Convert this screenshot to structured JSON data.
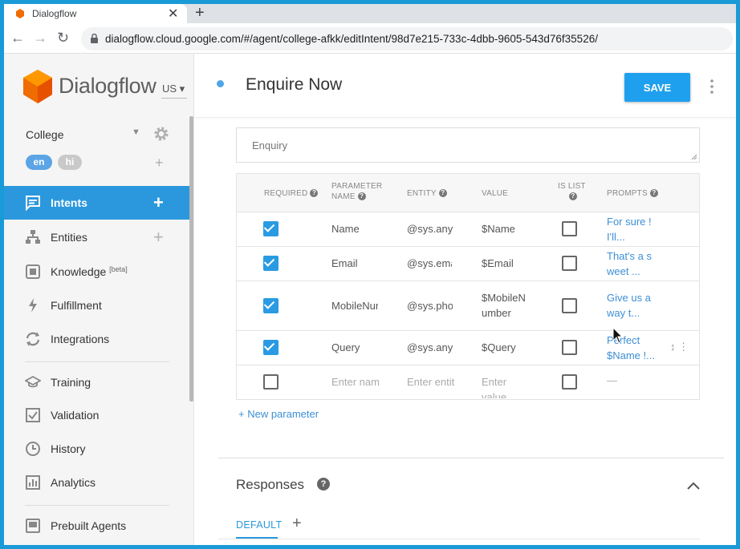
{
  "browser": {
    "tab_title": "Dialogflow",
    "tab_close": "✕",
    "new_tab": "+",
    "back": "←",
    "forward": "→",
    "reload": "↻",
    "url": "dialogflow.cloud.google.com/#/agent/college-afkk/editIntent/98d7e215-733c-4dbb-9605-543d76f35526/"
  },
  "sidebar": {
    "brand": "Dialogflow",
    "region": "US ▾",
    "agent": "College",
    "agent_caret": "▼",
    "languages": [
      "en",
      "hi"
    ],
    "add_language": "+",
    "items": [
      {
        "label": "Intents",
        "icon": "intents-icon",
        "active": true,
        "plus": "+"
      },
      {
        "label": "Entities",
        "icon": "entities-icon",
        "plus": "+"
      },
      {
        "label": "Knowledge",
        "sup": "[beta]",
        "icon": "knowledge-icon"
      },
      {
        "label": "Fulfillment",
        "icon": "fulfillment-icon"
      },
      {
        "label": "Integrations",
        "icon": "integrations-icon"
      },
      {
        "label": "Training",
        "icon": "training-icon"
      },
      {
        "label": "Validation",
        "icon": "validation-icon"
      },
      {
        "label": "History",
        "icon": "history-icon"
      },
      {
        "label": "Analytics",
        "icon": "analytics-icon"
      },
      {
        "label": "Prebuilt Agents",
        "icon": "prebuilt-agents-icon"
      }
    ]
  },
  "header": {
    "intent_name": "Enquire Now",
    "save_label": "SAVE"
  },
  "action": {
    "placeholder": "Enquiry"
  },
  "parameters": {
    "headers": {
      "required": "REQUIRED",
      "parameter_name_1": "PARAMETER",
      "parameter_name_2": "NAME",
      "entity": "ENTITY",
      "value": "VALUE",
      "is_list": "IS LIST",
      "prompts": "PROMPTS",
      "help": "?"
    },
    "rows": [
      {
        "required": true,
        "name": "Name",
        "entity": "@sys.any",
        "value": "$Name",
        "is_list": false,
        "prompt": "For sure ! I'll..."
      },
      {
        "required": true,
        "name": "Email",
        "entity": "@sys.ema",
        "value": "$Email",
        "is_list": false,
        "prompt": "That's a s weet ..."
      },
      {
        "required": true,
        "name": "MobileNur",
        "entity": "@sys.phor",
        "value": "$MobileN umber",
        "is_list": false,
        "prompt": "Give us a way t..."
      },
      {
        "required": true,
        "name": "Query",
        "entity": "@sys.any",
        "value": "$Query",
        "is_list": false,
        "prompt": "Perfect $Name !..."
      }
    ],
    "empty_row": {
      "name_placeholder": "Enter nam",
      "entity_placeholder": "Enter entit",
      "value_placeholder": "Enter value",
      "prompt": "—"
    },
    "row_tools": "↕ ⋮",
    "new_parameter": "+ New parameter"
  },
  "responses": {
    "title": "Responses",
    "help": "?",
    "tab_default": "DEFAULT",
    "tab_add": "+"
  },
  "colors": {
    "accent": "#2b98dd",
    "save": "#1fa0ef",
    "frame": "#1a9bd7"
  }
}
